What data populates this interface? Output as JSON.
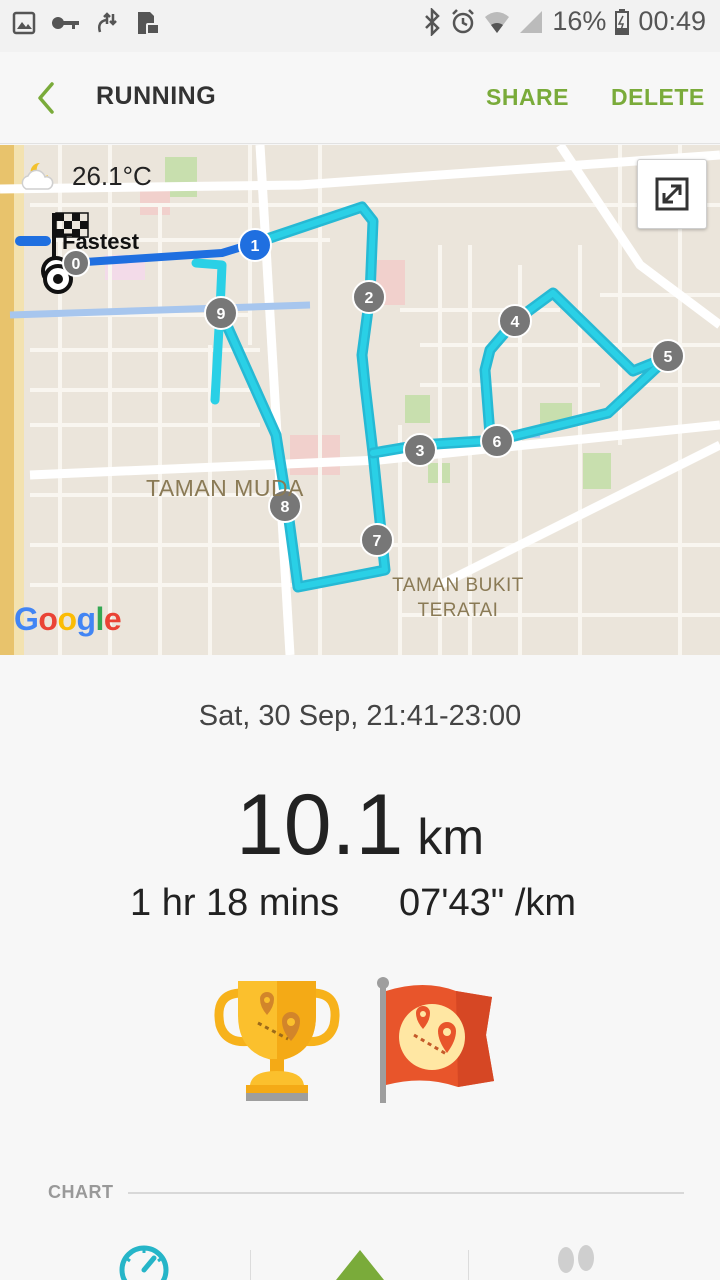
{
  "status_bar": {
    "battery": "16%",
    "time": "00:49"
  },
  "app_bar": {
    "title": "RUNNING",
    "share_label": "SHARE",
    "delete_label": "DELETE"
  },
  "map": {
    "weather": "26.1°C",
    "fastest_label": "Fastest",
    "places": [
      "TAMAN MUDA",
      "TAMAN BUKIT",
      "TERATAI"
    ],
    "provider_logo": "Google",
    "route_color": "#2ad0e6",
    "fastest_color": "#1f6fe0",
    "markers": [
      "0",
      "1",
      "2",
      "3",
      "4",
      "5",
      "6",
      "7",
      "8",
      "9"
    ]
  },
  "summary": {
    "date_range": "Sat, 30 Sep, 21:41-23:00",
    "distance_value": "10.1",
    "distance_unit": "km",
    "duration": "1 hr 18 mins",
    "pace": "07'43\" /km"
  },
  "badges": [
    "trophy-route-icon",
    "flag-route-icon"
  ],
  "chart": {
    "label": "CHART",
    "tabs": [
      "speed-gauge-icon",
      "elevation-icon",
      "steps-icon"
    ]
  },
  "colors": {
    "accent": "#7aab3a",
    "route": "#2ad0e6",
    "gauge": "#26b5c8",
    "mountain": "#7aab3a"
  }
}
